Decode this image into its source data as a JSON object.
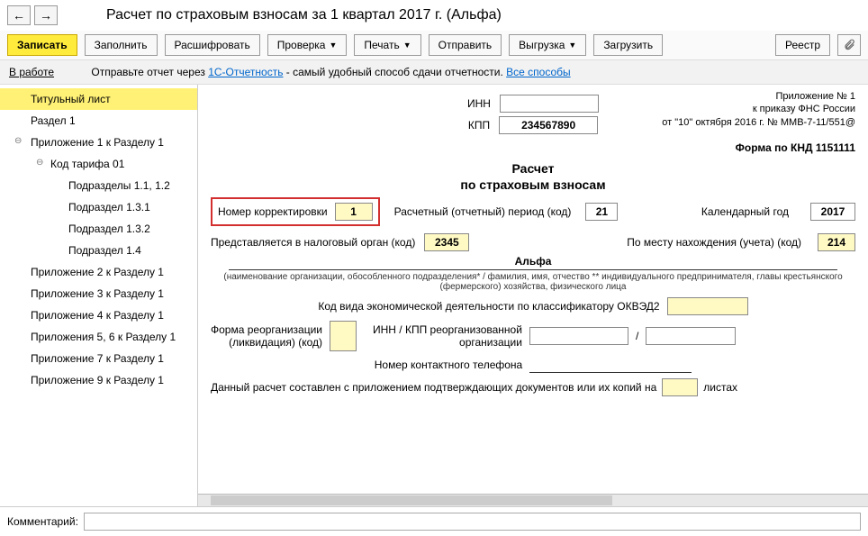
{
  "nav": {
    "back": "←",
    "forward": "→"
  },
  "title": "Расчет по страховым взносам за 1 квартал 2017 г. (Альфа)",
  "toolbar": {
    "save": "Записать",
    "fill": "Заполнить",
    "decode": "Расшифровать",
    "check": "Проверка",
    "print": "Печать",
    "send": "Отправить",
    "export": "Выгрузка",
    "load": "Загрузить",
    "registry": "Реестр"
  },
  "status": {
    "label": "В работе",
    "text1": "Отправьте отчет через ",
    "link1": "1С-Отчетность",
    "text2": " - самый удобный способ сдачи отчетности. ",
    "link2": "Все способы"
  },
  "tree": [
    "Титульный лист",
    "Раздел 1",
    "Приложение 1 к Разделу 1",
    "Код тарифа 01",
    "Подразделы 1.1, 1.2",
    "Подраздел 1.3.1",
    "Подраздел 1.3.2",
    "Подраздел 1.4",
    "Приложение 2 к Разделу 1",
    "Приложение 3 к Разделу 1",
    "Приложение 4 к Разделу 1",
    "Приложения 5, 6 к Разделу 1",
    "Приложение 7 к Разделу 1",
    "Приложение 9 к Разделу 1"
  ],
  "annex": {
    "l1": "Приложение № 1",
    "l2": "к приказу ФНС России",
    "l3": "от \"10\" октября 2016 г. № ММВ-7-11/551@"
  },
  "form": {
    "inn_lbl": "ИНН",
    "kpp_lbl": "КПП",
    "kpp_val": "234567890",
    "form_code": "Форма по КНД 1151111",
    "h1": "Расчет",
    "h2": "по страховым взносам",
    "corr_lbl": "Номер корректировки",
    "corr_val": "1",
    "period_lbl": "Расчетный (отчетный) период (код)",
    "period_val": "21",
    "year_lbl": "Календарный год",
    "year_val": "2017",
    "tax_lbl": "Представляется в налоговый орган (код)",
    "tax_val": "2345",
    "place_lbl": "По месту нахождения (учета) (код)",
    "place_val": "214",
    "org": "Альфа",
    "org_note": "(наименование организации, обособленного подразделения* / фамилия, имя, отчество ** индивидуального предпринимателя, главы крестьянского (фермерского) хозяйства, физического лица",
    "okved_lbl": "Код вида экономической деятельности по классификатору ОКВЭД2",
    "reorg_lbl1": "Форма реорганизации",
    "reorg_lbl2": "(ликвидация) (код)",
    "reorg_inn_lbl1": "ИНН / КПП реорганизованной",
    "reorg_inn_lbl2": "организации",
    "slash": "/",
    "phone_lbl": "Номер контактного телефона",
    "docs_lbl1": "Данный расчет составлен с приложением подтверждающих документов или их копий на",
    "docs_lbl2": "листах"
  },
  "comment_lbl": "Комментарий:"
}
